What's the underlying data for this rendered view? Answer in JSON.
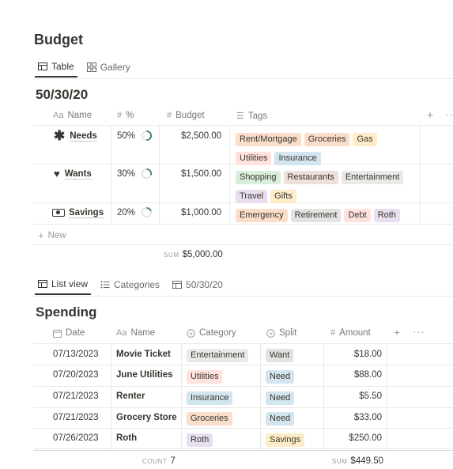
{
  "page_title": "Budget",
  "budget_tabs": [
    {
      "label": "Table",
      "icon": "table-icon",
      "active": true
    },
    {
      "label": "Gallery",
      "icon": "gallery-icon",
      "active": false
    }
  ],
  "budget": {
    "title": "50/30/20",
    "headers": {
      "name": "Name",
      "percent": "%",
      "budget": "Budget",
      "tags": "Tags"
    },
    "rows": [
      {
        "icon": "asterisk-icon",
        "name": "Needs",
        "percent": "50%",
        "percent_value": 0.5,
        "budget": "$2,500.00",
        "tags": [
          {
            "label": "Rent/Mortgage",
            "color": "#fadec9"
          },
          {
            "label": "Groceries",
            "color": "#fadec9"
          },
          {
            "label": "Gas",
            "color": "#fdecc8"
          },
          {
            "label": "Utilities",
            "color": "#ffe2dd"
          },
          {
            "label": "Insurance",
            "color": "#d3e5ef"
          }
        ]
      },
      {
        "icon": "heart-icon",
        "name": "Wants",
        "percent": "30%",
        "percent_value": 0.3,
        "budget": "$1,500.00",
        "tags": [
          {
            "label": "Shopping",
            "color": "#dbeddb"
          },
          {
            "label": "Restaurants",
            "color": "#eee0da"
          },
          {
            "label": "Entertainment",
            "color": "#e9e9e7"
          },
          {
            "label": "Travel",
            "color": "#e8deee"
          },
          {
            "label": "Gifts",
            "color": "#fdecc8"
          }
        ]
      },
      {
        "icon": "money-icon",
        "name": "Savings",
        "percent": "20%",
        "percent_value": 0.2,
        "budget": "$1,000.00",
        "tags": [
          {
            "label": "Emergency",
            "color": "#fadec9"
          },
          {
            "label": "Retirement",
            "color": "#e3e2e0"
          },
          {
            "label": "Debt",
            "color": "#ffe2dd"
          },
          {
            "label": "Roth",
            "color": "#e8deee"
          }
        ]
      }
    ],
    "new_label": "New",
    "sum_label": "SUM",
    "sum_value": "$5,000.00"
  },
  "spending_tabs": [
    {
      "label": "List view",
      "icon": "table-icon",
      "active": true
    },
    {
      "label": "Categories",
      "icon": "list-icon",
      "active": false
    },
    {
      "label": "50/30/20",
      "icon": "table-icon",
      "active": false
    }
  ],
  "spending": {
    "title": "Spending",
    "headers": {
      "date": "Date",
      "name": "Name",
      "category": "Category",
      "split": "Split",
      "amount": "Amount"
    },
    "rows": [
      {
        "date": "07/13/2023",
        "name": "Movie Ticket",
        "category": "Entertainment",
        "category_color": "#e9e9e7",
        "split": "Want",
        "split_color": "#e3e2e0",
        "amount": "$18.00"
      },
      {
        "date": "07/20/2023",
        "name": "June Utilities",
        "category": "Utilities",
        "category_color": "#ffe2dd",
        "split": "Need",
        "split_color": "#d3e5ef",
        "amount": "$88.00"
      },
      {
        "date": "07/21/2023",
        "name": "Renter",
        "category": "Insurance",
        "category_color": "#d3e5ef",
        "split": "Need",
        "split_color": "#d3e5ef",
        "amount": "$5.50"
      },
      {
        "date": "07/21/2023",
        "name": "Grocery Store",
        "category": "Groceries",
        "category_color": "#fadec9",
        "split": "Need",
        "split_color": "#d3e5ef",
        "amount": "$33.00"
      },
      {
        "date": "07/26/2023",
        "name": "Roth",
        "category": "Roth",
        "category_color": "#e8deee",
        "split": "Savings",
        "split_color": "#fdecc8",
        "amount": "$250.00"
      }
    ],
    "count_label": "COUNT",
    "count_value": "7",
    "sum_label": "SUM",
    "sum_value": "$449.50"
  }
}
